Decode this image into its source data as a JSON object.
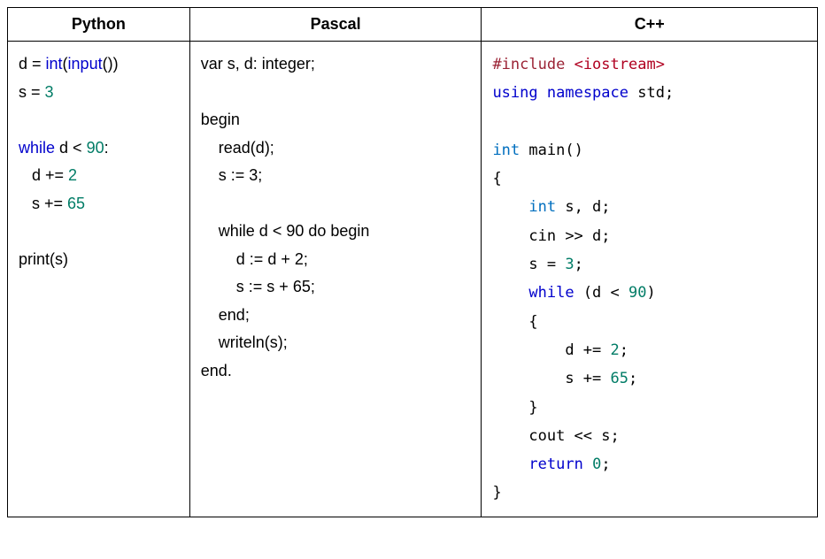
{
  "headers": {
    "python": "Python",
    "pascal": "Pascal",
    "cpp": "C++"
  },
  "python": {
    "l1_a": "d = ",
    "l1_b": "int",
    "l1_c": "(",
    "l1_d": "input",
    "l1_e": "())",
    "l2_a": "s = ",
    "l2_b": "3",
    "l3_a": "while",
    "l3_b": " d < ",
    "l3_c": "90",
    "l3_d": ":",
    "l4_a": "   d += ",
    "l4_b": "2",
    "l5_a": "   s += ",
    "l5_b": "65",
    "l6": "print(s)"
  },
  "pascal": {
    "l1": "var s, d: integer;",
    "l2": "begin",
    "l3": "    read(d);",
    "l4": "    s := 3;",
    "l5": "    while d < 90 do begin",
    "l6": "        d := d + 2;",
    "l7": "        s := s + 65;",
    "l8": "    end;",
    "l9": "    writeln(s);",
    "l10": "end."
  },
  "cpp": {
    "l1_a": "#include",
    "l1_b": " ",
    "l1_c": "<iostream>",
    "l2_a": "using",
    "l2_b": " ",
    "l2_c": "namespace",
    "l2_d": " std;",
    "l3_a": "int",
    "l3_b": " main()",
    "l4": "{",
    "l5_a": "    ",
    "l5_b": "int",
    "l5_c": " s, d;",
    "l6": "    cin >> d;",
    "l7_a": "    s = ",
    "l7_b": "3",
    "l7_c": ";",
    "l8_a": "    ",
    "l8_b": "while",
    "l8_c": " (d < ",
    "l8_d": "90",
    "l8_e": ")",
    "l9": "    {",
    "l10_a": "        d += ",
    "l10_b": "2",
    "l10_c": ";",
    "l11_a": "        s += ",
    "l11_b": "65",
    "l11_c": ";",
    "l12": "    }",
    "l13": "    cout << s;",
    "l14_a": "    ",
    "l14_b": "return",
    "l14_c": " ",
    "l14_d": "0",
    "l14_e": ";",
    "l15": "}"
  }
}
